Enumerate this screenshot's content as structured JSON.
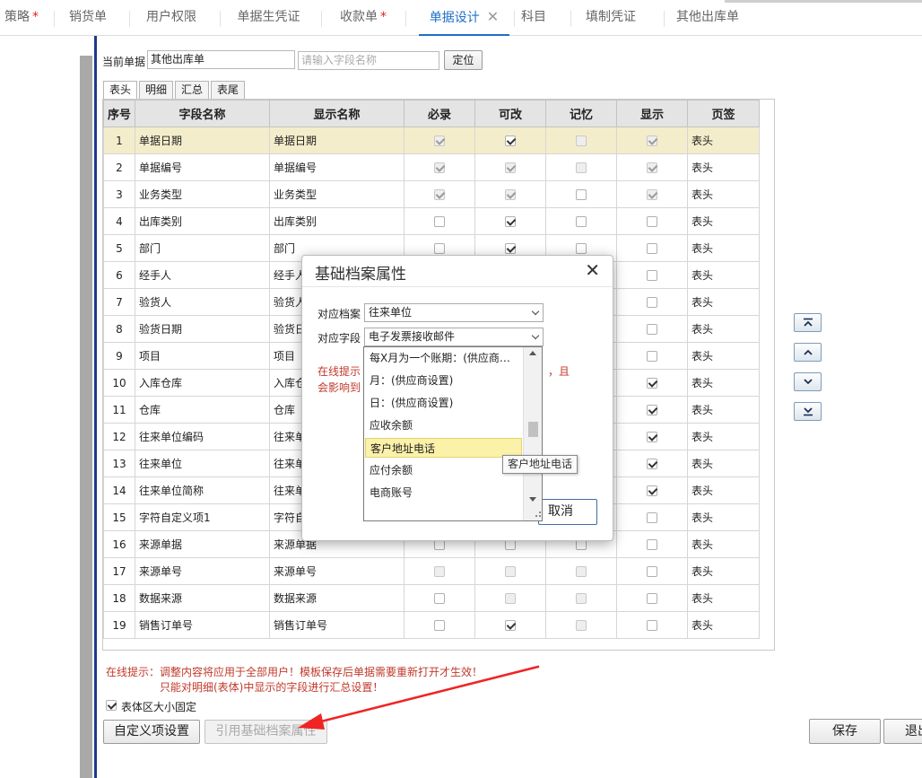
{
  "tabs": [
    {
      "label": "策略",
      "star": true
    },
    {
      "label": "销货单",
      "star": false
    },
    {
      "label": "用户权限",
      "star": false
    },
    {
      "label": "单据生凭证",
      "star": false
    },
    {
      "label": "收款单",
      "star": true
    },
    {
      "label": "单据设计",
      "star": false,
      "active": true,
      "close": "✕"
    },
    {
      "label": "科目",
      "star": false
    },
    {
      "label": "填制凭证",
      "star": false
    },
    {
      "label": "其他出库单",
      "star": false
    }
  ],
  "toolbar": {
    "current_doc_label": "当前单据",
    "current_doc_value": "其他出库单",
    "field_search_placeholder": "请输入字段名称",
    "locate_button": "定位"
  },
  "subtabs": [
    "表头",
    "明细",
    "汇总",
    "表尾"
  ],
  "grid": {
    "headers": [
      "序号",
      "字段名称",
      "显示名称",
      "必录",
      "可改",
      "记忆",
      "显示",
      "页签"
    ],
    "rows": [
      {
        "no": "1",
        "field": "单据日期",
        "display": "单据日期",
        "required": {
          "on": true,
          "dis": true
        },
        "editable": {
          "on": true,
          "dis": false
        },
        "memory": {
          "on": false,
          "dis": true
        },
        "show": {
          "on": true,
          "dis": true
        },
        "tab": "表头"
      },
      {
        "no": "2",
        "field": "单据编号",
        "display": "单据编号",
        "required": {
          "on": true,
          "dis": true
        },
        "editable": {
          "on": true,
          "dis": true
        },
        "memory": {
          "on": false,
          "dis": true
        },
        "show": {
          "on": true,
          "dis": true
        },
        "tab": "表头"
      },
      {
        "no": "3",
        "field": "业务类型",
        "display": "业务类型",
        "required": {
          "on": true,
          "dis": true
        },
        "editable": {
          "on": true,
          "dis": true
        },
        "memory": {
          "on": false,
          "dis": false
        },
        "show": {
          "on": true,
          "dis": true
        },
        "tab": "表头"
      },
      {
        "no": "4",
        "field": "出库类别",
        "display": "出库类别",
        "required": {
          "on": false,
          "dis": false
        },
        "editable": {
          "on": true,
          "dis": false
        },
        "memory": {
          "on": false,
          "dis": false
        },
        "show": {
          "on": false,
          "dis": false
        },
        "tab": "表头"
      },
      {
        "no": "5",
        "field": "部门",
        "display": "部门",
        "required": {
          "on": false,
          "dis": false
        },
        "editable": {
          "on": true,
          "dis": false
        },
        "memory": {
          "on": false,
          "dis": false
        },
        "show": {
          "on": false,
          "dis": false
        },
        "tab": "表头"
      },
      {
        "no": "6",
        "field": "经手人",
        "display": "经手人",
        "required": {
          "on": false,
          "dis": false
        },
        "editable": {
          "on": false,
          "dis": false
        },
        "memory": {
          "on": false,
          "dis": false
        },
        "show": {
          "on": false,
          "dis": false
        },
        "tab": "表头"
      },
      {
        "no": "7",
        "field": "验货人",
        "display": "验货人",
        "required": {
          "on": false,
          "dis": false
        },
        "editable": {
          "on": false,
          "dis": false
        },
        "memory": {
          "on": false,
          "dis": false
        },
        "show": {
          "on": false,
          "dis": false
        },
        "tab": "表头"
      },
      {
        "no": "8",
        "field": "验货日期",
        "display": "验货日期",
        "required": {
          "on": false,
          "dis": false
        },
        "editable": {
          "on": false,
          "dis": false
        },
        "memory": {
          "on": false,
          "dis": false
        },
        "show": {
          "on": false,
          "dis": false
        },
        "tab": "表头"
      },
      {
        "no": "9",
        "field": "项目",
        "display": "项目",
        "required": {
          "on": false,
          "dis": false
        },
        "editable": {
          "on": false,
          "dis": false
        },
        "memory": {
          "on": false,
          "dis": false
        },
        "show": {
          "on": false,
          "dis": false
        },
        "tab": "表头"
      },
      {
        "no": "10",
        "field": "入库仓库",
        "display": "入库仓库",
        "required": {
          "on": false,
          "dis": false
        },
        "editable": {
          "on": false,
          "dis": false
        },
        "memory": {
          "on": false,
          "dis": false
        },
        "show": {
          "on": true,
          "dis": false
        },
        "tab": "表头"
      },
      {
        "no": "11",
        "field": "仓库",
        "display": "仓库",
        "required": {
          "on": false,
          "dis": false
        },
        "editable": {
          "on": false,
          "dis": false
        },
        "memory": {
          "on": false,
          "dis": false
        },
        "show": {
          "on": true,
          "dis": false
        },
        "tab": "表头"
      },
      {
        "no": "12",
        "field": "往来单位编码",
        "display": "往来单位编码",
        "required": {
          "on": false,
          "dis": false
        },
        "editable": {
          "on": false,
          "dis": false
        },
        "memory": {
          "on": false,
          "dis": false
        },
        "show": {
          "on": true,
          "dis": false
        },
        "tab": "表头"
      },
      {
        "no": "13",
        "field": "往来单位",
        "display": "往来单位",
        "required": {
          "on": false,
          "dis": false
        },
        "editable": {
          "on": false,
          "dis": false
        },
        "memory": {
          "on": false,
          "dis": false
        },
        "show": {
          "on": true,
          "dis": false
        },
        "tab": "表头"
      },
      {
        "no": "14",
        "field": "往来单位简称",
        "display": "往来单位简称",
        "required": {
          "on": false,
          "dis": false
        },
        "editable": {
          "on": false,
          "dis": false
        },
        "memory": {
          "on": false,
          "dis": false
        },
        "show": {
          "on": true,
          "dis": false
        },
        "tab": "表头"
      },
      {
        "no": "15",
        "field": "字符自定义项1",
        "display": "字符自定义项1",
        "required": {
          "on": false,
          "dis": false
        },
        "editable": {
          "on": false,
          "dis": false
        },
        "memory": {
          "on": false,
          "dis": false
        },
        "show": {
          "on": false,
          "dis": false
        },
        "tab": "表头"
      },
      {
        "no": "16",
        "field": "来源单据",
        "display": "来源单据",
        "required": {
          "on": false,
          "dis": false
        },
        "editable": {
          "on": false,
          "dis": false
        },
        "memory": {
          "on": false,
          "dis": false
        },
        "show": {
          "on": false,
          "dis": false
        },
        "tab": "表头"
      },
      {
        "no": "17",
        "field": "来源单号",
        "display": "来源单号",
        "required": {
          "on": false,
          "dis": true
        },
        "editable": {
          "on": false,
          "dis": true
        },
        "memory": {
          "on": false,
          "dis": true
        },
        "show": {
          "on": false,
          "dis": false
        },
        "tab": "表头"
      },
      {
        "no": "18",
        "field": "数据来源",
        "display": "数据来源",
        "required": {
          "on": false,
          "dis": false
        },
        "editable": {
          "on": false,
          "dis": true
        },
        "memory": {
          "on": false,
          "dis": true
        },
        "show": {
          "on": false,
          "dis": false
        },
        "tab": "表头"
      },
      {
        "no": "19",
        "field": "销售订单号",
        "display": "销售订单号",
        "required": {
          "on": false,
          "dis": false
        },
        "editable": {
          "on": true,
          "dis": false
        },
        "memory": {
          "on": false,
          "dis": true
        },
        "show": {
          "on": false,
          "dis": false
        },
        "tab": "表头"
      }
    ]
  },
  "hints": {
    "line1": "在线提示：调整内容将应用于全部用户！模板保存后单据需要重新打开才生效！",
    "line2": "只能对明细(表体)中显示的字段进行汇总设置！"
  },
  "fixed_size_label": "表体区大小固定",
  "bottom_buttons": {
    "custom_items": "自定义项设置",
    "ref_base": "引用基础档案属性",
    "save": "保存",
    "exit": "退出"
  },
  "modal": {
    "title": "基础档案属性",
    "close": "✕",
    "archive_label": "对应档案",
    "archive_value": "往来单位",
    "field_label": "对应字段",
    "field_value": "电子发票接收邮件",
    "hint_line1": "在线提示",
    "hint_line1_tail": "，且",
    "hint_line2": "会影响到",
    "cancel": "取消"
  },
  "dropdown": {
    "items": [
      "每X月为一个账期：(供应商…",
      "月：(供应商设置)",
      "日：(供应商设置)",
      "应收余额",
      "客户地址电话",
      "应付余额",
      "电商账号"
    ],
    "highlight_index": 4
  },
  "tooltip": "客户地址电话",
  "colors": {
    "accent": "#1e6fc8",
    "hint_red": "#c0392b",
    "selected_row": "#f4edcb",
    "arrow_red": "#f02424"
  }
}
